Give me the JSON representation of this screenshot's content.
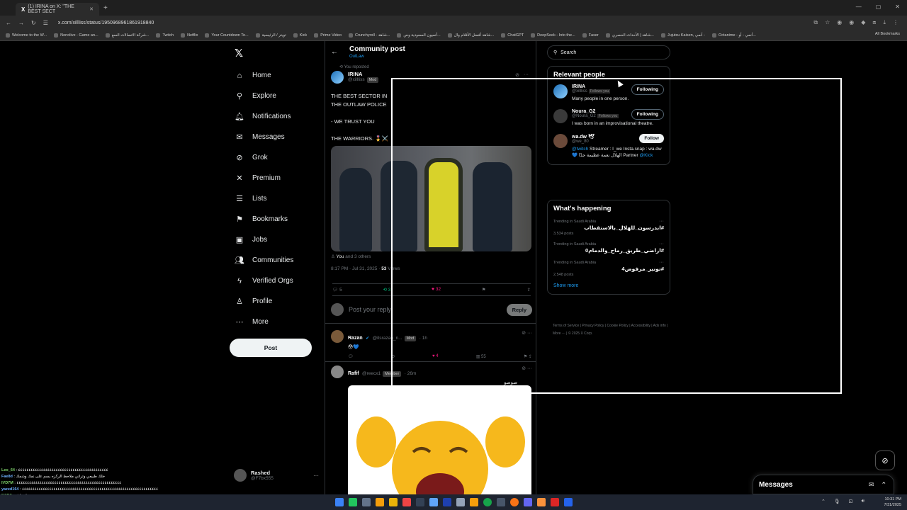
{
  "browser": {
    "tab_title": "(1) IRINA on X: \"THE BEST SECT",
    "url": "x.com/xillliss/status/1950968961861918840",
    "bookmarks": [
      "Welcome to the W...",
      "Nonolive - Game an...",
      "شركة الاتصالات السع...",
      "Twitch",
      "Netflix",
      "Your Countdown To...",
      "تويتر / الرئيسية",
      "Kick",
      "Prime Video",
      "Crunchyroll - شاهد...",
      "أنميون السعودية وص...",
      "شاهد أفضل الأفلام وال...",
      "ChatGPT",
      "DeepSeek - Into the...",
      "Faser",
      "شاهد | الأحداث الحصري...",
      "Jujutsu Kaisen, أنمي -",
      "Octanime - أنمي - أو..."
    ],
    "all_bookmarks": "All Bookmarks"
  },
  "nav": {
    "items": [
      {
        "label": "Home",
        "icon": "home-icon",
        "glyph": "⌂"
      },
      {
        "label": "Explore",
        "icon": "search-icon",
        "glyph": "⚲"
      },
      {
        "label": "Notifications",
        "icon": "bell-icon",
        "glyph": "🔔︎"
      },
      {
        "label": "Messages",
        "icon": "mail-icon",
        "glyph": "✉"
      },
      {
        "label": "Grok",
        "icon": "grok-icon",
        "glyph": "⊘"
      },
      {
        "label": "Premium",
        "icon": "x-premium-icon",
        "glyph": "✕"
      },
      {
        "label": "Lists",
        "icon": "list-icon",
        "glyph": "☰"
      },
      {
        "label": "Bookmarks",
        "icon": "bookmark-icon",
        "glyph": "⚑"
      },
      {
        "label": "Jobs",
        "icon": "briefcase-icon",
        "glyph": "▣"
      },
      {
        "label": "Communities",
        "icon": "people-icon",
        "glyph": "👥︎"
      },
      {
        "label": "Verified Orgs",
        "icon": "lightning-icon",
        "glyph": "ϟ"
      },
      {
        "label": "Profile",
        "icon": "person-icon",
        "glyph": "♙"
      },
      {
        "label": "More",
        "icon": "more-circle-icon",
        "glyph": "⋯"
      }
    ],
    "post_button": "Post",
    "account": {
      "name": "Rashed",
      "handle": "@F7bx555"
    }
  },
  "main": {
    "title": "Community post",
    "subtitle": "OutLaw",
    "repost_note": "You reposted",
    "author": {
      "name": "IRINA",
      "handle": "@xillliss",
      "badge": "Mod"
    },
    "text": "THE BEST SECTOR IN\nTHE OUTLAW POLICE\n\n- WE TRUST YOU\n\nTHE WARRIORS. 🎖️⚔️",
    "tagged": "You",
    "tagged_rest": "and 3 others",
    "timestamp": "8:17 PM · Jul 31, 2025 ·",
    "views_num": "53",
    "views_label": "Views",
    "stats": {
      "replies": "5",
      "reposts": "3",
      "likes": "32"
    },
    "reply_placeholder": "Post your reply",
    "reply_button": "Reply",
    "comments": [
      {
        "name": "Razan",
        "handle": "@itsrazan_n...",
        "badge": "Mod",
        "time": "· 1h",
        "text": "😳💙",
        "likes": "4",
        "views": "55"
      },
      {
        "name": "Rafif",
        "handle": "@reecx1",
        "badge": "Member",
        "time": "· 26m",
        "text": "صوصو"
      }
    ]
  },
  "right": {
    "search_placeholder": "Search",
    "relevant_title": "Relevant people",
    "people": [
      {
        "name": "IRINA",
        "handle": "@xillliss",
        "follows_you": "Follows you",
        "button": "Following",
        "bio": "Many people in one person."
      },
      {
        "name": "Noura_G2",
        "handle": "@Noura_G2",
        "follows_you": "Follows you",
        "button": "Following",
        "bio": "I was born in an improvisational theatre."
      },
      {
        "name": "wa.dw 🕊",
        "handle": "@we_80",
        "follows_you": "",
        "button": "Follow",
        "bio_link": "@twitch",
        "bio": "Streamer : I_we Insta.snap : wa.dw 💙 الهلال نعمة عظيمة جدًا Partner",
        "bio_link2": "@Kick"
      }
    ],
    "happening_title": "What's happening",
    "trends": [
      {
        "context": "Trending in Saudi Arabia",
        "name": "#ابدرسون_للهلال_بالاستقطاب",
        "count": "3,534 posts"
      },
      {
        "context": "Trending in Saudi Arabia",
        "name": "#اراضي_طريق_رماح_والدمام0",
        "count": ""
      },
      {
        "context": "Trending in Saudi Arabia",
        "name": "#تونير_مرفوض4",
        "count": "2,548 posts"
      }
    ],
    "show_more": "Show more",
    "footer": [
      "Terms of Service",
      "Privacy Policy",
      "Cookie Policy",
      "Accessibility",
      "Ads info",
      "More ···",
      "© 2025 X Corp."
    ]
  },
  "drawer": {
    "title": "Messages"
  },
  "chat": [
    {
      "user": "Leo_64",
      "text": ": ٤٤٤٤٤٤٤٤٤٤٤٤٤٤٤٤٤٤٤٤٤٤٤٤٤٤٤٤٤٤٤٤٤٤٤٤٤٤٤٤٤٤٤"
    },
    {
      "user": "Fae8d",
      "text": ": خلك طبيعي وتراني ملاحظ الركزه بسم على نمك وشمك"
    },
    {
      "user": "IVD7M",
      "text": ": ٤٤٤٤٤٤٤٤٤٤٤٤٤٤٤٤٤٤٤٤٤٤٤٤٤٤٤٤٤٤٤٤٤٤٤٤٤٤٤٤٤٤٤٤٤٤٤٤٤٤"
    },
    {
      "user": "yazed164",
      "text": ": ٤٤٤٤٤٤٤٤٤٤٤٤٤٤٤٤٤٤٤٤٤٤٤٤٤٤٤٤٤٤٤٤٤٤٤٤٤٤٤٤٤٤٤٤٤٤٤٤٤٤٤٤٤٤٤٤٤٤٤٤٤٤٤٤٤"
    },
    {
      "user": "M6B8",
      "text": ": صعبيات اش"
    }
  ],
  "taskbar": {
    "time": "10:31 PM",
    "date": "7/31/2025"
  }
}
